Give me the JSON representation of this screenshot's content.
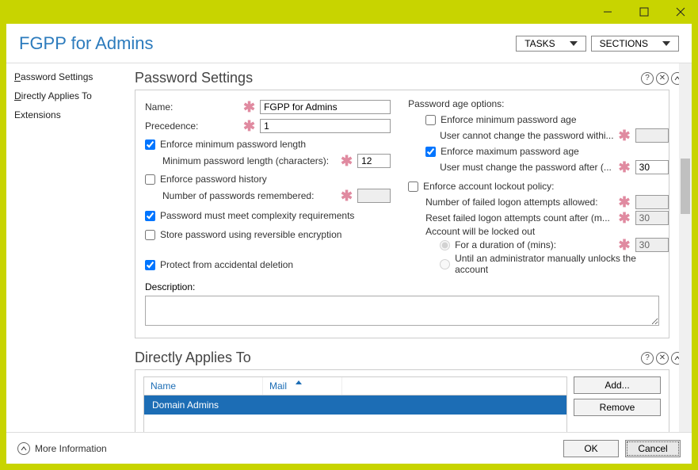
{
  "titlebar": {
    "minimize": "—",
    "maximize": "▢",
    "close": "✕"
  },
  "header": {
    "title": "FGPP for Admins",
    "tasks": "TASKS",
    "sections": "SECTIONS"
  },
  "sidebar": {
    "items": [
      "Password Settings",
      "Directly Applies To",
      "Extensions"
    ]
  },
  "ps": {
    "title": "Password Settings",
    "name_lbl": "Name:",
    "name_val": "FGPP for Admins",
    "prec_lbl": "Precedence:",
    "prec_val": "1",
    "minlen_chk": "Enforce minimum password length",
    "minlen_lbl": "Minimum password length (characters):",
    "minlen_val": "12",
    "hist_chk": "Enforce password history",
    "hist_lbl": "Number of passwords remembered:",
    "hist_val": "",
    "complex_chk": "Password must meet complexity requirements",
    "rev_chk": "Store password using reversible encryption",
    "protect_chk": "Protect from accidental deletion",
    "desc_lbl": "Description:",
    "age_title": "Password age options:",
    "minage_chk": "Enforce minimum password age",
    "minage_lbl": "User cannot change the password withi...",
    "minage_val": "",
    "maxage_chk": "Enforce maximum password age",
    "maxage_lbl": "User must change the password after (...",
    "maxage_val": "30",
    "lockout_chk": "Enforce account lockout policy:",
    "fail_lbl": "Number of failed logon attempts allowed:",
    "fail_val": "",
    "reset_lbl": "Reset failed logon attempts count after (m...",
    "reset_val": "30",
    "acct_lbl": "Account will be locked out",
    "dur_lbl": "For a duration of (mins):",
    "dur_val": "30",
    "until_lbl": "Until an administrator manually unlocks the account"
  },
  "dat": {
    "title": "Directly Applies To",
    "col_name": "Name",
    "col_mail": "Mail",
    "row0": "Domain Admins",
    "add": "Add...",
    "remove": "Remove"
  },
  "footer": {
    "more": "More Information",
    "ok": "OK",
    "cancel": "Cancel"
  }
}
